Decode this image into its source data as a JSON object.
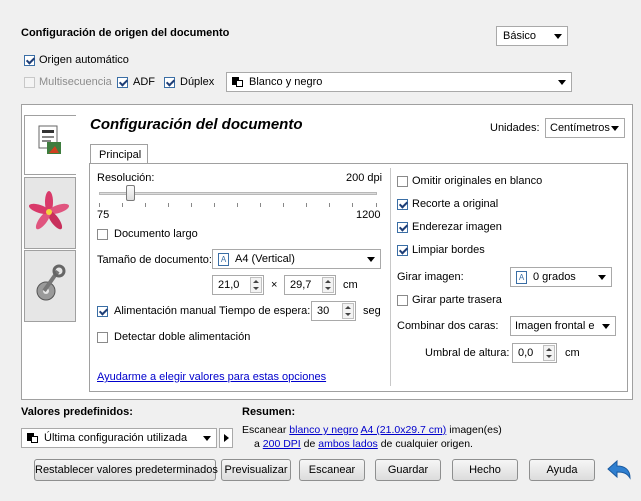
{
  "header": {
    "title": "Configuración de origen del documento",
    "mode_value": "Básico",
    "auto_source": "Origen automático",
    "multisequence": "Multisecuencia",
    "adf": "ADF",
    "duplex": "Dúplex",
    "color_mode": "Blanco y negro"
  },
  "panel": {
    "title": "Configuración del documento",
    "units_label": "Unidades:",
    "units_value": "Centímetros",
    "tab": "Principal"
  },
  "left": {
    "resolution_label": "Resolución:",
    "resolution_value": "200 dpi",
    "resolution_min": "75",
    "resolution_max": "1200",
    "resolution_fraction": 0.11,
    "long_doc": "Documento largo",
    "size_label": "Tamaño de documento:",
    "size_value": "A4 (Vertical)",
    "width": "21,0",
    "times": "×",
    "height": "29,7",
    "cm": "cm",
    "manual_feed": "Alimentación manual",
    "wait_label": "Tiempo de espera:",
    "wait_value": "30",
    "seg": "seg",
    "double_feed": "Detectar doble alimentación",
    "help_link": "Ayudarme a elegir valores para estas opciones"
  },
  "right": {
    "skip_blank": "Omitir originales en blanco",
    "crop": "Recorte a original",
    "straighten": "Enderezar imagen",
    "clean_edges": "Limpiar bordes",
    "rotate_label": "Girar imagen:",
    "rotate_value": "0 grados",
    "rotate_back": "Girar parte trasera",
    "combine_label": "Combinar dos caras:",
    "combine_value": "Imagen frontal e",
    "height_threshold_label": "Umbral de altura:",
    "height_threshold_value": "0,0",
    "cm": "cm"
  },
  "footer": {
    "presets_label": "Valores predefinidos:",
    "preset_value": "Última configuración utilizada",
    "summary_label": "Resumen:",
    "summary_1": "Escanear",
    "summary_link_1": "blanco y negro",
    "summary_link_2": "A4 (21.0x29.7 cm)",
    "summary_2": "imagen(es)",
    "summary_3": "a",
    "summary_link_3": "200 DPI",
    "summary_4": "de",
    "summary_link_4": "ambos lados",
    "summary_5": "de cualquier origen."
  },
  "buttons": {
    "reset": "Restablecer valores predeterminados",
    "preview": "Previsualizar",
    "scan": "Escanear",
    "save": "Guardar",
    "done": "Hecho",
    "help": "Ayuda"
  },
  "colors": {
    "accent": "#3a6ea5",
    "link": "#0000cc",
    "back_arrow": "#2f7fd0"
  }
}
